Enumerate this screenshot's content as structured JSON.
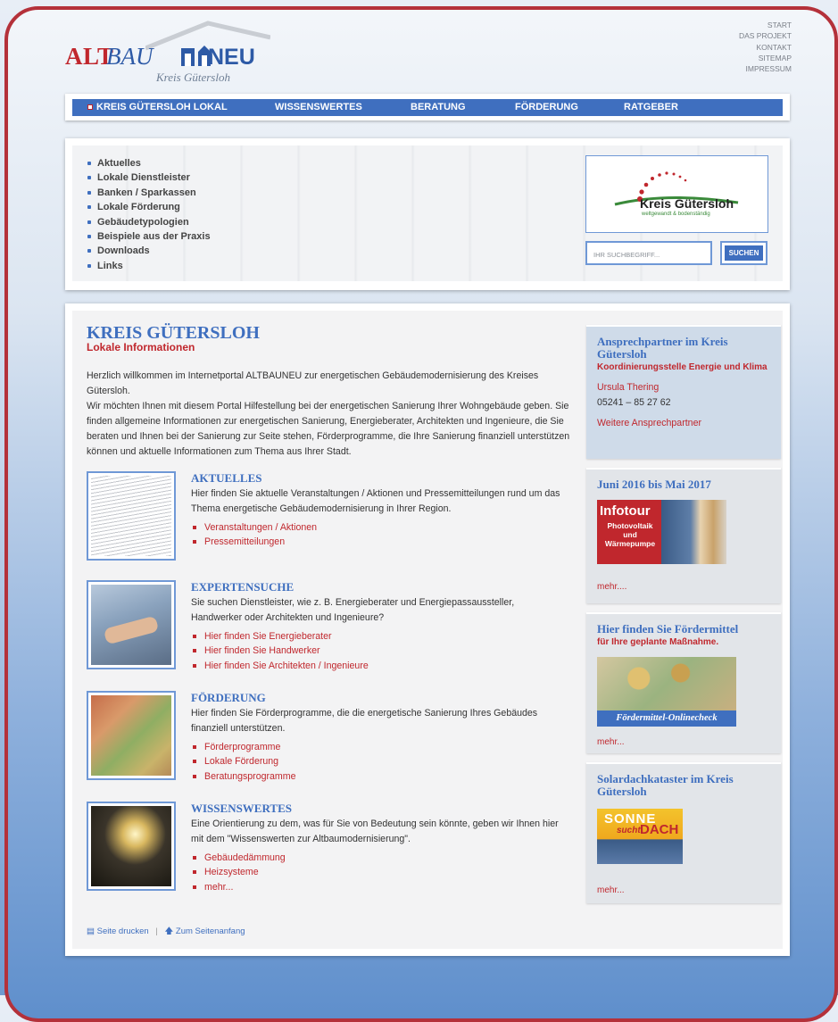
{
  "logo": {
    "alt": "ALT",
    "bau": "BAU",
    "neu": "NEU",
    "sub": "Kreis Gütersloh"
  },
  "topnav": [
    "START",
    "DAS PROJEKT",
    "KONTAKT",
    "SITEMAP",
    "IMPRESSUM"
  ],
  "mainnav": [
    "KREIS GÜTERSLOH LOKAL",
    "WISSENSWERTES",
    "BERATUNG",
    "FÖRDERUNG",
    "RATGEBER"
  ],
  "subnav": [
    "Aktuelles",
    "Lokale Dienstleister",
    "Banken / Sparkassen",
    "Lokale Förderung",
    "Gebäudetypologien",
    "Beispiele aus der Praxis",
    "Downloads",
    "Links"
  ],
  "kreislogo": {
    "name": "Kreis Gütersloh",
    "slogan": "weltgewandt & bodenständig"
  },
  "search": {
    "placeholder": "IHR SUCHBEGRIFF...",
    "button": "SUCHEN"
  },
  "page": {
    "title": "KREIS GÜTERSLOH",
    "subtitle": "Lokale Informationen",
    "intro1": "Herzlich willkommen im Internetportal ALTBAUNEU zur energetischen Gebäudemodernisierung des Kreises Gütersloh.",
    "intro2": "Wir möchten Ihnen mit diesem Portal Hilfestellung bei der energetischen Sanierung Ihrer Wohngebäude geben. Sie finden allgemeine Informationen zur energetischen Sanierung, Energieberater, Architekten und Ingenieure, die Sie beraten und Ihnen bei der Sanierung zur Seite stehen, Förderprogramme, die Ihre Sanierung finanziell unterstützen können und aktuelle Informationen zum Thema aus Ihrer Stadt."
  },
  "sections": [
    {
      "title": "AKTUELLES",
      "desc": "Hier finden Sie aktuelle Veranstaltungen / Aktionen und Pressemitteilungen rund um das Thema energetische Gebäudemodernisierung in Ihrer Region.",
      "links": [
        "Veranstaltungen / Aktionen",
        "Pressemitteilungen"
      ]
    },
    {
      "title": "EXPERTENSUCHE",
      "desc": "Sie suchen Dienstleister, wie z. B. Energieberater und Energiepassaussteller, Handwerker oder Architekten und Ingenieure?",
      "links": [
        "Hier finden Sie Energieberater",
        "Hier finden Sie Handwerker",
        "Hier finden Sie Architekten / Ingenieure"
      ]
    },
    {
      "title": "FÖRDERUNG",
      "desc": "Hier finden Sie Förderprogramme, die die energetische Sanierung Ihres Gebäudes finanziell unterstützen.",
      "links": [
        "Förderprogramme",
        "Lokale Förderung",
        "Beratungsprogramme"
      ]
    },
    {
      "title": "WISSENSWERTES",
      "desc": "Eine Orientierung zu dem, was für Sie von Bedeutung sein könnte, geben wir Ihnen hier mit dem \"Wissenswerten zur Altbaumodernisierung\".",
      "links": [
        "Gebäudedämmung",
        "Heizsysteme",
        "mehr..."
      ]
    }
  ],
  "footer": {
    "print": "Seite drucken",
    "top": "Zum Seitenanfang"
  },
  "sidebar": {
    "contact": {
      "title": "Ansprechpartner im Kreis Gütersloh",
      "org": "Koordinierungsstelle Energie und Klima",
      "name": "Ursula Thering",
      "phone": "05241 – 85 27 62",
      "more": "Weitere Ansprechpartner"
    },
    "infotour": {
      "title": "Juni 2016 bis Mai 2017",
      "banner_title": "Infotour",
      "banner_l1": "Photovoltaik",
      "banner_l2": "und",
      "banner_l3": "Wärmepumpe",
      "more": "mehr...."
    },
    "foerder": {
      "title": "Hier finden Sie Fördermittel",
      "sub": "für Ihre geplante Maßnahme.",
      "banner": "Fördermittel-Onlinecheck",
      "more": "mehr..."
    },
    "solar": {
      "title": "Solardachkataster im Kreis Gütersloh",
      "banner_l1": "SONNE",
      "banner_l2": "sucht",
      "banner_l3": "DACH",
      "more": "mehr..."
    }
  },
  "colors": {
    "accent": "#3f6fbf",
    "red": "#c0272d",
    "frame": "#b4313a"
  }
}
